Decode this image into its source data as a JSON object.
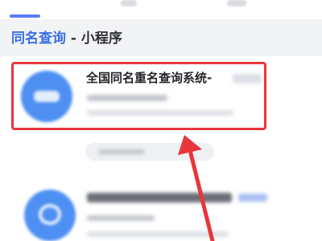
{
  "section": {
    "title_name": "同名查询",
    "title_sep": " - ",
    "title_type": "小程序"
  },
  "result": {
    "title": "全国同名重名查询系统-"
  },
  "colors": {
    "accent_blue": "#3a6fe1",
    "highlight_red": "#e8363c",
    "icon_blue": "#4d8ff2"
  },
  "icons": {
    "first_result": "miniapp-logo-icon",
    "second_result": "chat-bubble-logo-icon",
    "annotation": "red-arrow-icon"
  }
}
